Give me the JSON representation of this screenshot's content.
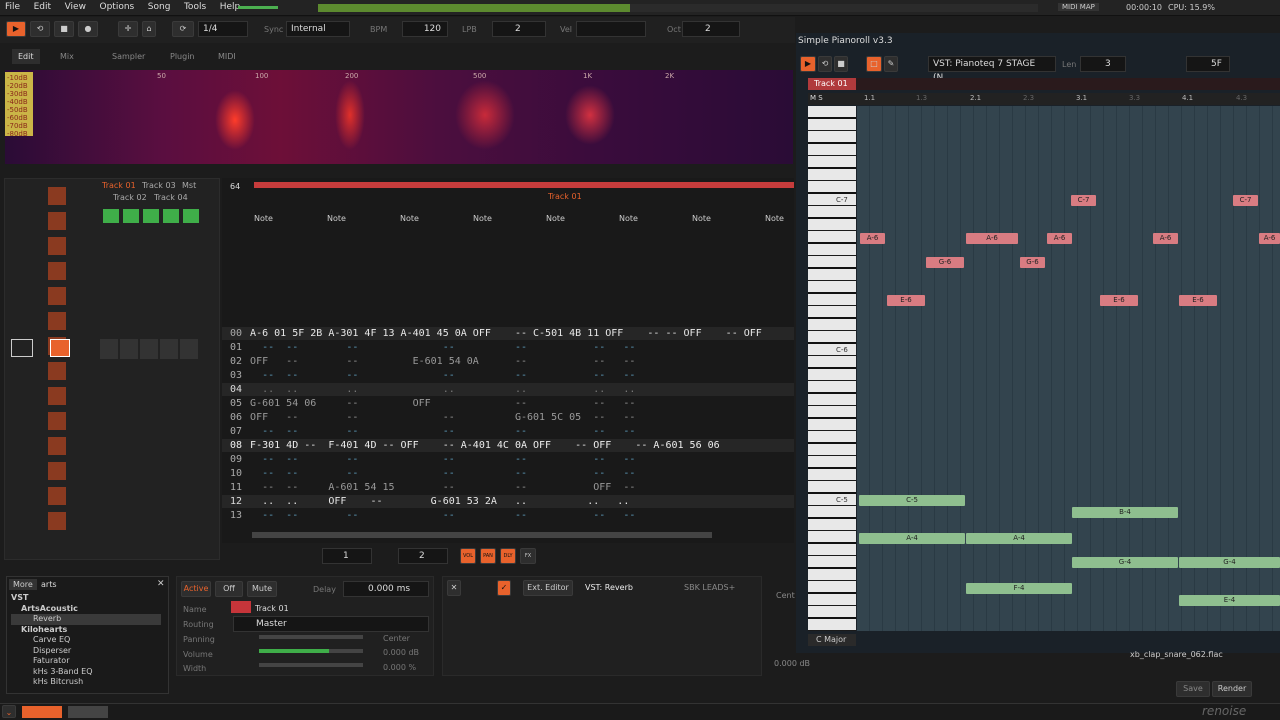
{
  "menu": [
    "File",
    "Edit",
    "View",
    "Options",
    "Song",
    "Tools",
    "Help"
  ],
  "topright": {
    "midi_map": "MIDI MAP",
    "time": "00:00:10",
    "cpu": "CPU: 15.9%"
  },
  "transport": {
    "octave_step": "1/4",
    "sync_label": "Sync",
    "sync_value": "Internal",
    "bpm_label": "BPM",
    "bpm": "120",
    "lpb_label": "LPB",
    "lpb": "2",
    "vel_label": "Vel",
    "oct_label": "Oct",
    "oct": "2"
  },
  "tabs": [
    "Edit",
    "Mix",
    "Sampler",
    "Plugin",
    "MIDI"
  ],
  "spectrum": {
    "db_labels": [
      "-10dB",
      "-20dB",
      "-30dB",
      "-40dB",
      "-50dB",
      "-60dB",
      "-70dB",
      "-80dB"
    ],
    "freq_labels": [
      "50",
      "100",
      "200",
      "500",
      "1K",
      "2K"
    ]
  },
  "tracks": {
    "names": [
      "Track 01",
      "Track 03",
      "Mst",
      "Track 02",
      "Track 04"
    ],
    "play": "PLAY"
  },
  "pattern": {
    "num": "64",
    "track_name": "Track 01",
    "sub_label": "Note",
    "sub_play": "PLAY",
    "rows": [
      {
        "n": "00",
        "t": "A-6 01 5F 2B A-301 4F 13 A-401 45 0A OFF    -- C-501 4B 11 OFF    -- -- OFF    -- OFF"
      },
      {
        "n": "01",
        "t": "  --  --        --              --          --           --   --"
      },
      {
        "n": "02",
        "t": "OFF   --        --         E-601 54 0A      --           --   --"
      },
      {
        "n": "03",
        "t": "  --  --        --              --          --           --   --"
      },
      {
        "n": "04",
        "t": "  ..  ..        ..              ..          ..           ..   .."
      },
      {
        "n": "05",
        "t": "G-601 54 06     --         OFF              --           --   --"
      },
      {
        "n": "06",
        "t": "OFF   --        --              --          G-601 5C 05  --   --"
      },
      {
        "n": "07",
        "t": "  --  --        --              --          --           --   --"
      },
      {
        "n": "08",
        "t": "F-301 4D --  F-401 4D -- OFF    -- A-401 4C 0A OFF    -- OFF    -- A-601 56 06"
      },
      {
        "n": "09",
        "t": "  --  --        --              --          --           --   --"
      },
      {
        "n": "10",
        "t": "  --  --        --              --          --           --   --"
      },
      {
        "n": "11",
        "t": "  --  --     A-601 54 15        --          --           OFF  --"
      },
      {
        "n": "12",
        "t": "  ..  ..     OFF    --        G-601 53 2A   ..          ..   .."
      },
      {
        "n": "13",
        "t": "  --  --        --              --          --           --   --"
      }
    ]
  },
  "pattern_bottom": {
    "lines": "1",
    "step": "2"
  },
  "browser": {
    "more": "More",
    "search": "arts",
    "items": [
      "VST",
      "ArtsAcoustic",
      "Reverb",
      "Kilohearts",
      "Carve EQ",
      "Disperser",
      "Faturator",
      "kHs 3-Band EQ",
      "kHs Bitcrush"
    ]
  },
  "trackprops": {
    "active": "Active",
    "off": "Off",
    "mute": "Mute",
    "delay_label": "Delay",
    "delay": "0.000 ms",
    "name_label": "Name",
    "name": "Track 01",
    "routing_label": "Routing",
    "routing": "Master",
    "panning_label": "Panning",
    "panning": "Center",
    "volume_label": "Volume",
    "volume": "0.000 dB",
    "width_label": "Width",
    "width": "0.000 %"
  },
  "devchain": {
    "ext_editor": "Ext. Editor",
    "device": "VST: Reverb",
    "preset": "SBK LEADS+"
  },
  "pianoroll": {
    "title": "Simple Pianoroll v3.3",
    "vst": "VST: Pianoteq 7 STAGE (N...",
    "len_label": "Len",
    "len": "3",
    "vel": "5F",
    "track": "Track 01",
    "scale": "C Major",
    "bars": [
      "1.1",
      "1.3",
      "2.1",
      "2.3",
      "3.1",
      "3.3",
      "4.1",
      "4.3"
    ],
    "keys": [
      "C-7",
      "C-6",
      "C-5"
    ],
    "notes": [
      {
        "n": "C-7",
        "c": "red"
      },
      {
        "n": "C-7",
        "c": "red"
      },
      {
        "n": "A-6",
        "c": "red"
      },
      {
        "n": "A-6",
        "c": "red"
      },
      {
        "n": "A-6",
        "c": "red"
      },
      {
        "n": "A-6",
        "c": "red"
      },
      {
        "n": "A-6",
        "c": "red"
      },
      {
        "n": "G-6",
        "c": "red"
      },
      {
        "n": "G-6",
        "c": "red"
      },
      {
        "n": "E-6",
        "c": "red"
      },
      {
        "n": "E-6",
        "c": "red"
      },
      {
        "n": "E-6",
        "c": "red"
      },
      {
        "n": "C-5",
        "c": "green"
      },
      {
        "n": "B-4",
        "c": "green"
      },
      {
        "n": "A-4",
        "c": "green"
      },
      {
        "n": "A-4",
        "c": "green"
      },
      {
        "n": "G-4",
        "c": "green"
      },
      {
        "n": "G-4",
        "c": "green"
      },
      {
        "n": "F-4",
        "c": "green"
      },
      {
        "n": "E-4",
        "c": "green"
      }
    ]
  },
  "sampler_strip": {
    "cent": "Cent",
    "db": "0.000 dB",
    "file": "xb_clap_snare_062.flac",
    "save": "Save",
    "render": "Render"
  },
  "logo": "renoise"
}
